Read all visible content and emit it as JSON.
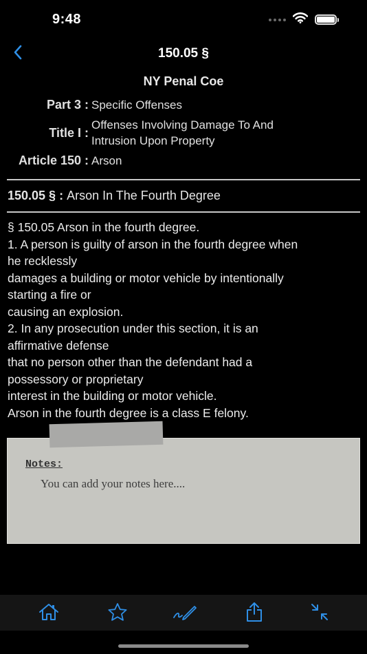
{
  "status_bar": {
    "time": "9:48"
  },
  "nav": {
    "title": "150.05 §",
    "back_icon": "chevron-left-icon"
  },
  "meta": {
    "code_title": "NY Penal Coe",
    "rows": [
      {
        "label": "Part 3 :",
        "value": "Specific Offenses"
      },
      {
        "label": "Title I :",
        "value": "Offenses Involving Damage To And Intrusion Upon Property"
      },
      {
        "label": "Article 150 :",
        "value": "Arson"
      }
    ]
  },
  "section": {
    "number": "150.05 §",
    "separator": " : ",
    "name": "Arson In The Fourth Degree"
  },
  "body_lines": [
    "§ 150.05 Arson in the fourth degree.",
    "1. A person is guilty of arson in the fourth degree when",
    "he recklessly",
    "damages a building or motor vehicle by intentionally",
    "starting a fire or",
    "causing an explosion.",
    "2. In any prosecution under this section, it is an",
    "affirmative defense",
    "that no person other than the defendant had a",
    "possessory or proprietary",
    "interest in the building or motor vehicle.",
    "Arson in the fourth degree is a class E felony."
  ],
  "notes": {
    "label": "Notes:",
    "placeholder": "You can add your notes here....",
    "value": ""
  },
  "tab_bar": {
    "items": [
      {
        "name": "home",
        "icon": "home-icon"
      },
      {
        "name": "favorite",
        "icon": "star-icon"
      },
      {
        "name": "edit",
        "icon": "pen-icon"
      },
      {
        "name": "share",
        "icon": "share-icon"
      },
      {
        "name": "collapse",
        "icon": "collapse-arrows-icon"
      }
    ]
  },
  "colors": {
    "accent": "#2f8fe6",
    "background": "#000000",
    "notes_card": "#c6c6c1",
    "tab_bar": "#151515"
  }
}
